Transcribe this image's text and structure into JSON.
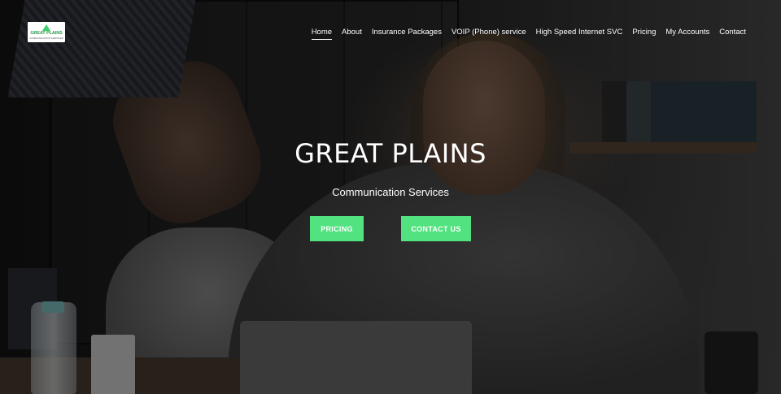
{
  "brand": {
    "logo_text": "GREAT PLAINS",
    "logo_subtext": "COMMUNICATION SERVICES",
    "accent_color": "#52e27f"
  },
  "nav": {
    "items": [
      {
        "label": "Home",
        "active": true
      },
      {
        "label": "About",
        "active": false
      },
      {
        "label": "Insurance Packages",
        "active": false
      },
      {
        "label": "VOIP (Phone) service",
        "active": false
      },
      {
        "label": "High Speed Internet SVC",
        "active": false
      },
      {
        "label": "Pricing",
        "active": false
      },
      {
        "label": "My Accounts",
        "active": false
      },
      {
        "label": "Contact",
        "active": false
      }
    ]
  },
  "hero": {
    "title": "GREAT PLAINS",
    "subtitle": "Communication Services",
    "buttons": {
      "pricing_label": "PRICING",
      "contact_label": "CONTACT US"
    }
  }
}
